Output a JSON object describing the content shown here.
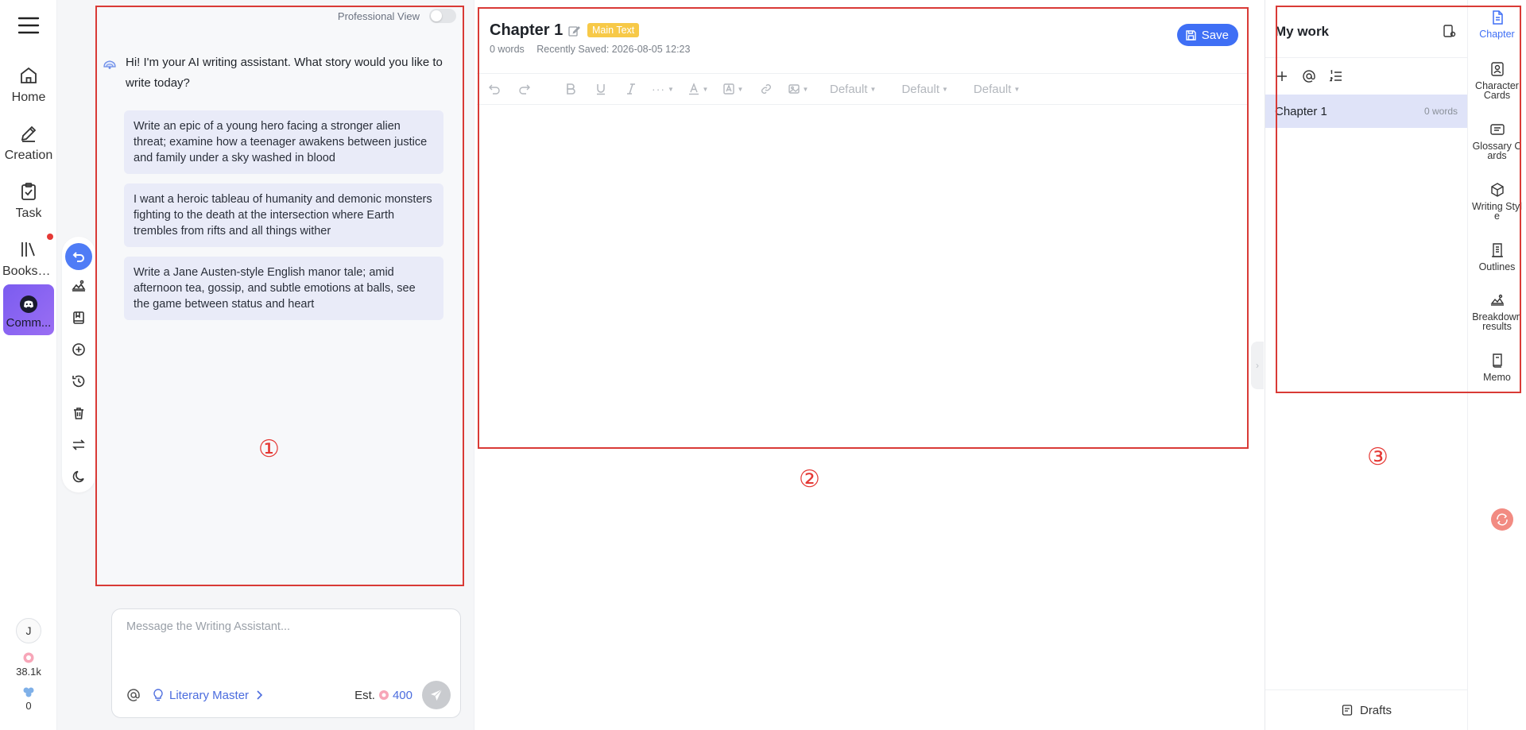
{
  "nav": {
    "items": [
      {
        "label": "Home",
        "icon": "home-icon"
      },
      {
        "label": "Creation",
        "icon": "pen-icon"
      },
      {
        "label": "Task",
        "icon": "clipboard-icon"
      },
      {
        "label": "Booksh...",
        "icon": "bookshelf-icon"
      },
      {
        "label": "Comm...",
        "icon": "discord-icon"
      }
    ],
    "avatar_initial": "J",
    "credits": "38.1k",
    "tokens": "0"
  },
  "chat": {
    "professional_view_label": "Professional View",
    "greeting": "Hi! I'm your AI writing assistant. What story would you like to write today?",
    "suggestions": [
      "Write an epic of a young hero facing a stronger alien threat; examine how a teenager awakens between justice and family under a sky washed in blood",
      "I want a heroic tableau of humanity and demonic monsters fighting to the death at the intersection where Earth trembles from rifts and all things wither",
      "Write a Jane Austen-style English manor tale; amid afternoon tea, gossip, and subtle emotions at balls, see the game between status and heart"
    ],
    "input_placeholder": "Message the Writing Assistant...",
    "mode_label": "Literary Master",
    "est_label": "Est.",
    "est_value": "400",
    "rail_tools": [
      "undo-icon",
      "breakdown-icon",
      "book-save-icon",
      "add-circle-icon",
      "history-icon",
      "trash-icon",
      "swap-icon",
      "moon-icon"
    ]
  },
  "editor": {
    "title": "Chapter 1",
    "badge": "Main Text",
    "word_count": "0 words",
    "saved_label": "Recently Saved: 2026-08-05 12:23",
    "save_label": "Save",
    "font_select_1": "Default",
    "font_select_2": "Default",
    "font_select_3": "Default"
  },
  "work": {
    "title": "My work",
    "chapters": [
      {
        "name": "Chapter 1",
        "words": "0 words"
      }
    ],
    "drafts_label": "Drafts"
  },
  "right_rail": {
    "items": [
      {
        "label": "Chapter",
        "icon": "chapter-icon"
      },
      {
        "label": "Character Cards",
        "icon": "character-card-icon"
      },
      {
        "label": "Glossary Cards",
        "icon": "glossary-icon"
      },
      {
        "label": "Writing Style",
        "icon": "cube-icon"
      },
      {
        "label": "Outlines",
        "icon": "outline-icon"
      },
      {
        "label": "Breakdown results",
        "icon": "breakdown-icon"
      },
      {
        "label": "Memo",
        "icon": "memo-icon"
      }
    ]
  },
  "annotations": {
    "one": "①",
    "two": "②",
    "three": "③"
  },
  "colors": {
    "accent": "#3f6ff5",
    "badge": "#f7c948",
    "annotation": "#d93a36",
    "community": "#7b5cf0"
  }
}
